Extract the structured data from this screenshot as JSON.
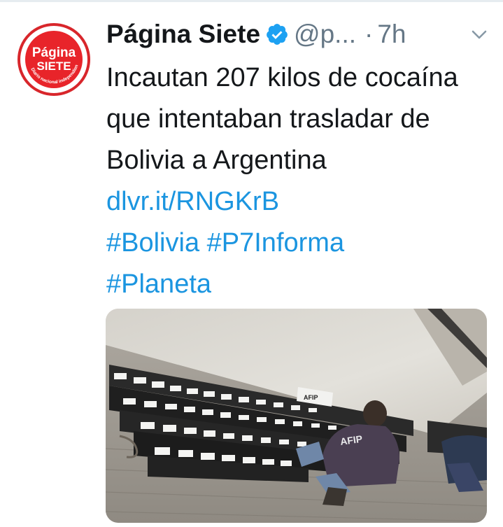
{
  "tweet": {
    "author_name": "Página Siete",
    "handle": "@p...",
    "separator": "·",
    "time": "7h",
    "text_plain": "Incautan 207 kilos de cocaína que intentaban trasladar de Bolivia a Argentina",
    "link": "dlvr.it/RNGKrB",
    "hashtags": [
      "#Bolivia",
      "#P7Informa",
      "#Planeta"
    ]
  },
  "avatar": {
    "logo_line1": "Página",
    "logo_line2": "SIETE",
    "logo_tagline": "Diario nacional independiente"
  },
  "media": {
    "package_labels": [
      "153",
      "154",
      "155",
      "156",
      "157",
      "158",
      "103",
      "104",
      "105",
      "106",
      "107",
      "108",
      "109",
      "1",
      "2",
      "3"
    ],
    "shirt_text": "AFIP",
    "sign_text": "AFIP"
  },
  "colors": {
    "link": "#1b95e0",
    "text": "#14171a",
    "muted": "#657786",
    "brand_red": "#e8242a",
    "verified": "#1da1f2"
  },
  "icons": {
    "verified": "verified-badge-icon",
    "menu": "chevron-down-icon"
  }
}
